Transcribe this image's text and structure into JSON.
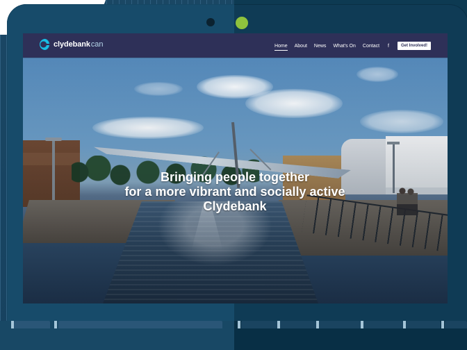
{
  "site": {
    "brand": {
      "primary": "clydebank",
      "secondary": "can",
      "logo_icon": "clydebank-can-logo-icon"
    },
    "nav": {
      "items": [
        {
          "label": "Home",
          "active": true
        },
        {
          "label": "About",
          "active": false
        },
        {
          "label": "News",
          "active": false
        },
        {
          "label": "What's On",
          "active": false
        },
        {
          "label": "Contact",
          "active": false
        }
      ],
      "social_icon": "f",
      "cta_label": "Get Involved!"
    },
    "hero": {
      "line1": "Bringing people together",
      "line2": "for a more vibrant and socially active",
      "line3": "Clydebank"
    }
  },
  "colors": {
    "header": "#2e3058",
    "accent_green": "#8fc23d",
    "logo_blue": "#18bfe6",
    "frame_dark": "#0f3b55"
  }
}
